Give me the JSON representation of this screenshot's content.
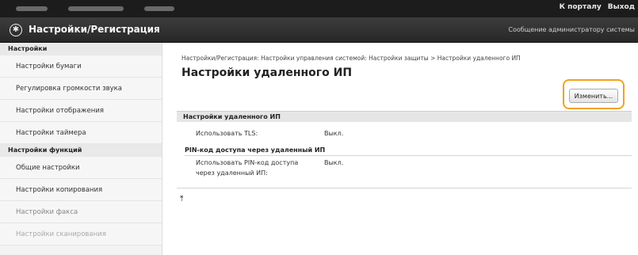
{
  "topbar": {
    "link_portal": "К порталу",
    "link_logout": "Выход"
  },
  "titlebar": {
    "app_title": "Настройки/Регистрация",
    "admin_message": "Сообщение администратору системы"
  },
  "sidebar": {
    "section1": "Настройки",
    "items1": [
      "Настройки бумаги",
      "Регулировка громкости звука",
      "Настройки отображения",
      "Настройки таймера"
    ],
    "section2": "Настройки функций",
    "items2": [
      "Общие настройки",
      "Настройки копирования",
      "Настройки факса",
      "Настройки сканирования"
    ]
  },
  "main": {
    "breadcrumb": "Настройки/Регистрация: Настройки управления системой: Настройки защиты > Настройки удаленного ИП",
    "title": "Настройки удаленного ИП",
    "edit_button": "Изменить...",
    "section_title": "Настройки удаленного ИП",
    "use_tls_label": "Использовать TLS:",
    "use_tls_value": "Выкл.",
    "pin_header": "PIN-код доступа через удаленный ИП",
    "use_pin_label_1": "Использовать PIN-код доступа",
    "use_pin_label_2": "через удаленный ИП:",
    "use_pin_value": "Выкл."
  },
  "colors": {
    "highlight": "#f2a21b",
    "topbar": "#1c1c1c",
    "titlebar": "#2f2f2f"
  }
}
